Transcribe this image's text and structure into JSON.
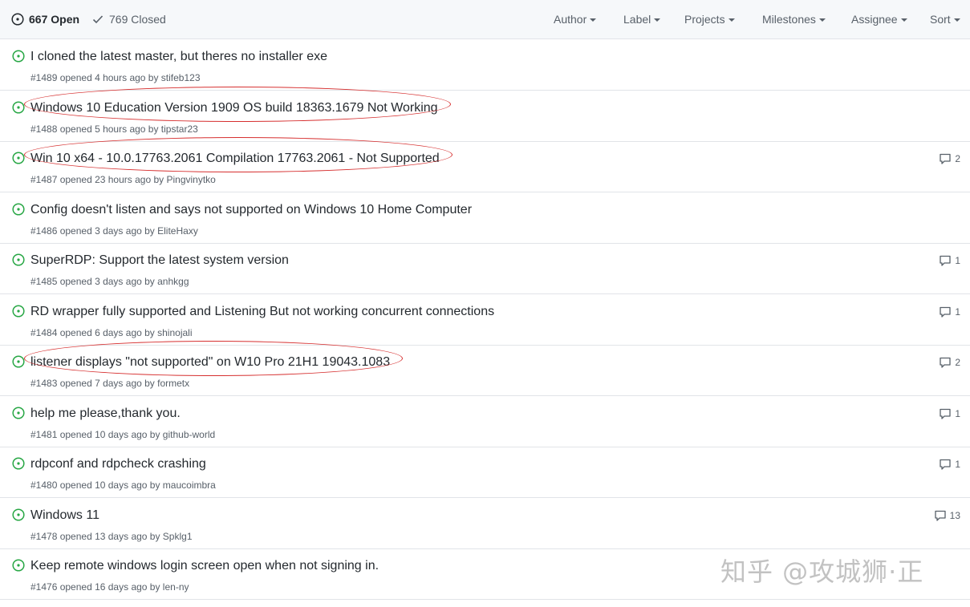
{
  "header": {
    "open_label": "667 Open",
    "closed_label": "769 Closed",
    "filters": [
      {
        "label": "Author",
        "icon": "caret-down-icon"
      },
      {
        "label": "Label",
        "icon": "caret-down-icon"
      },
      {
        "label": "Projects",
        "icon": "caret-down-icon"
      },
      {
        "label": "Milestones",
        "icon": "caret-down-icon"
      },
      {
        "label": "Assignee",
        "icon": "caret-down-icon"
      },
      {
        "label": "Sort",
        "icon": "caret-down-icon"
      }
    ]
  },
  "colors": {
    "open_icon": "#28a745",
    "highlight": "#d62f2f"
  },
  "issues": [
    {
      "title": "I cloned the latest master, but theres no installer exe",
      "meta": "#1489 opened 4 hours ago by stifeb123",
      "comments": "",
      "highlighted": false
    },
    {
      "title": "Windows 10 Education Version 1909 OS build 18363.1679 Not Working",
      "meta": "#1488 opened 5 hours ago by tipstar23",
      "comments": "",
      "highlighted": true
    },
    {
      "title": "Win 10 x64 - 10.0.17763.2061 Compilation 17763.2061 - Not Supported",
      "meta": "#1487 opened 23 hours ago by Pingvinytko",
      "comments": "2",
      "highlighted": true
    },
    {
      "title": "Config doesn't listen and says not supported on Windows 10 Home Computer",
      "meta": "#1486 opened 3 days ago by EliteHaxy",
      "comments": "",
      "highlighted": false
    },
    {
      "title": "SuperRDP: Support the latest system version",
      "meta": "#1485 opened 3 days ago by anhkgg",
      "comments": "1",
      "highlighted": false
    },
    {
      "title": "RD wrapper fully supported and Listening But not working concurrent connections",
      "meta": "#1484 opened 6 days ago by shinojali",
      "comments": "1",
      "highlighted": false
    },
    {
      "title": "listener displays \"not supported\" on W10 Pro 21H1 19043.1083",
      "meta": "#1483 opened 7 days ago by formetx",
      "comments": "2",
      "highlighted": true
    },
    {
      "title": "help me please,thank you.",
      "meta": "#1481 opened 10 days ago by github-world",
      "comments": "1",
      "highlighted": false
    },
    {
      "title": "rdpconf and rdpcheck crashing",
      "meta": "#1480 opened 10 days ago by maucoimbra",
      "comments": "1",
      "highlighted": false
    },
    {
      "title": "Windows 11",
      "meta": "#1478 opened 13 days ago by Spklg1",
      "comments": "13",
      "highlighted": false
    },
    {
      "title": "Keep remote windows login screen open when not signing in.",
      "meta": "#1476 opened 16 days ago by len-ny",
      "comments": "",
      "highlighted": false
    }
  ],
  "watermark": "知乎 @攻城狮·正"
}
